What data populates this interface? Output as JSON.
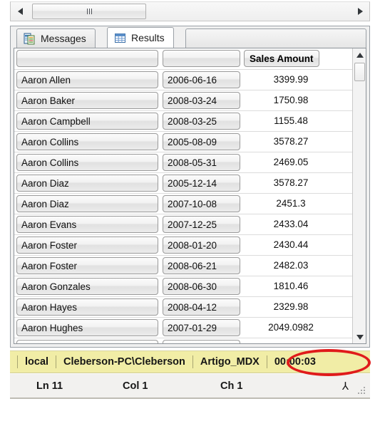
{
  "hscroll": {
    "left_arrow_icon": "triangle-left-icon",
    "right_arrow_icon": "triangle-right-icon",
    "thumb_grip_icon": "grip-lines-icon"
  },
  "tabs": [
    {
      "label": "Messages",
      "icon": "messages-document-icon",
      "active": false
    },
    {
      "label": "Results",
      "icon": "results-grid-icon",
      "active": true
    }
  ],
  "grid": {
    "columns": [
      "",
      "",
      "Sales Amount"
    ],
    "rows": [
      {
        "name": "Aaron  Allen",
        "date": "2006-06-16",
        "amount": "3399.99"
      },
      {
        "name": "Aaron  Baker",
        "date": "2008-03-24",
        "amount": "1750.98"
      },
      {
        "name": "Aaron  Campbell",
        "date": "2008-03-25",
        "amount": "1155.48"
      },
      {
        "name": "Aaron  Collins",
        "date": "2005-08-09",
        "amount": "3578.27"
      },
      {
        "name": "Aaron  Collins",
        "date": "2008-05-31",
        "amount": "2469.05"
      },
      {
        "name": "Aaron  Diaz",
        "date": "2005-12-14",
        "amount": "3578.27"
      },
      {
        "name": "Aaron  Diaz",
        "date": "2007-10-08",
        "amount": "2451.3"
      },
      {
        "name": "Aaron  Evans",
        "date": "2007-12-25",
        "amount": "2433.04"
      },
      {
        "name": "Aaron  Foster",
        "date": "2008-01-20",
        "amount": "2430.44"
      },
      {
        "name": "Aaron  Foster",
        "date": "2008-06-21",
        "amount": "2482.03"
      },
      {
        "name": "Aaron  Gonzales",
        "date": "2008-06-30",
        "amount": "1810.46"
      },
      {
        "name": "Aaron  Hayes",
        "date": "2008-04-12",
        "amount": "2329.98"
      },
      {
        "name": "Aaron  Hughes",
        "date": "2007-01-29",
        "amount": "2049.0982"
      },
      {
        "name": "",
        "date": "",
        "amount": ""
      }
    ],
    "vscroll": {
      "up_arrow_icon": "triangle-up-icon",
      "down_arrow_icon": "triangle-down-icon"
    }
  },
  "statusbar": {
    "server": "local",
    "user": "Cleberson-PC\\Cleberson",
    "database": "Artigo_MDX",
    "elapsed": "00:00:03",
    "highlight_color": "#e01b1b",
    "background_color": "#f1eda6"
  },
  "positionbar": {
    "line": "Ln 11",
    "column": "Col 1",
    "character": "Ch 1",
    "insert_mode": "⅄",
    "resize_grip_icon": "resize-grip-icon"
  }
}
